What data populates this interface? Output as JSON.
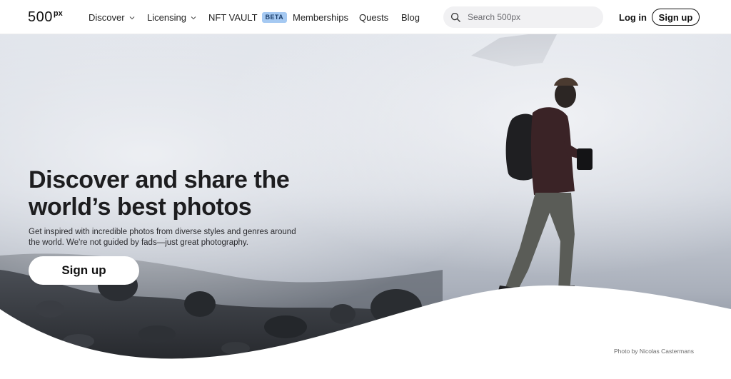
{
  "brand": {
    "logo_main": "500",
    "logo_sup": "px"
  },
  "nav": {
    "discover": "Discover",
    "licensing": "Licensing",
    "nft_vault": "NFT VAULT",
    "nft_badge": "BETA",
    "memberships": "Memberships",
    "quests": "Quests",
    "blog": "Blog"
  },
  "search": {
    "placeholder": "Search 500px",
    "value": ""
  },
  "auth": {
    "login": "Log in",
    "signup": "Sign up"
  },
  "hero": {
    "title_line1": "Discover and share the",
    "title_line2": "world’s best photos",
    "subtitle": "Get inspired with incredible photos from diverse styles and genres around the world. We're not guided by fads—just great photography.",
    "cta": "Sign up",
    "photo_credit": "Photo by Nicolas Castermans"
  },
  "footer_credit": "Photo by Nicolas Castermans",
  "colors": {
    "accent_badge": "#a5c9f2",
    "text_dark": "#1d1d1f",
    "button_bg": "#ffffff"
  },
  "icons": {
    "search": "search-icon",
    "chevron": "chevron-down-icon"
  }
}
